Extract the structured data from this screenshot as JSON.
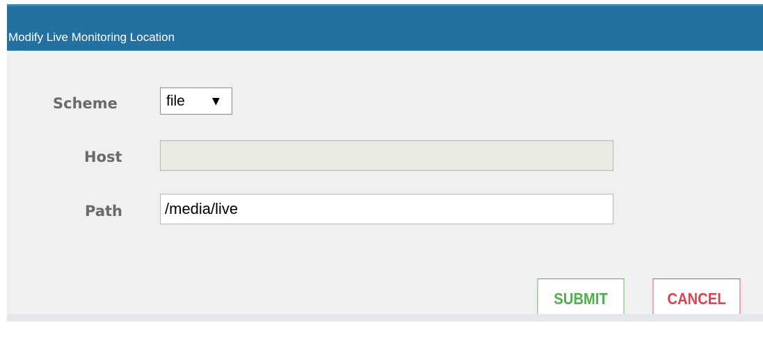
{
  "dialog": {
    "title": "Modify Live Monitoring Location"
  },
  "form": {
    "scheme": {
      "label": "Scheme",
      "selected": "file"
    },
    "host": {
      "label": "Host",
      "value": ""
    },
    "path": {
      "label": "Path",
      "value": "/media/live"
    }
  },
  "actions": {
    "submit_label": "SUBMIT",
    "cancel_label": "CANCEL"
  },
  "colors": {
    "titlebar": "#2470a0",
    "submit": "#4fae50",
    "cancel": "#dc4450"
  }
}
